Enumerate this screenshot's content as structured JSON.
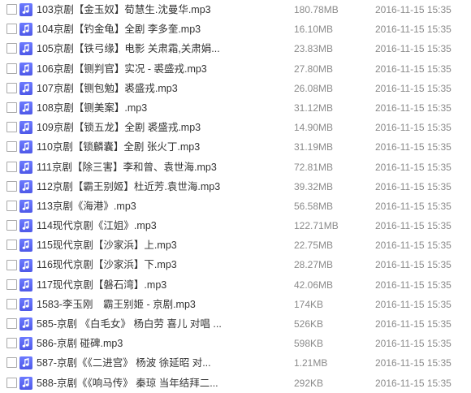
{
  "colors": {
    "icon_bg": "#5863f0",
    "text": "#333333",
    "meta_text": "#8a8a8a",
    "checkbox_border": "#a9a9a9"
  },
  "icons": {
    "file_type": "music-note-icon"
  },
  "files": [
    {
      "name": "103京剧【金玉奴】荀慧生.沈曼华.mp3",
      "size": "180.78MB",
      "date": "2016-11-15 15:35"
    },
    {
      "name": "104京剧【钓金龟】全剧 李多奎.mp3",
      "size": "16.10MB",
      "date": "2016-11-15 15:35"
    },
    {
      "name": "105京剧【铁弓缘】电影 关肃霜,关肃娟...",
      "size": "23.83MB",
      "date": "2016-11-15 15:35"
    },
    {
      "name": "106京剧【铡判官】实况 - 裘盛戎.mp3",
      "size": "27.80MB",
      "date": "2016-11-15 15:35"
    },
    {
      "name": "107京剧【铡包勉】裘盛戎.mp3",
      "size": "26.08MB",
      "date": "2016-11-15 15:35"
    },
    {
      "name": "108京剧【铡美案】.mp3",
      "size": "31.12MB",
      "date": "2016-11-15 15:35"
    },
    {
      "name": "109京剧【锁五龙】全剧 裘盛戎.mp3",
      "size": "14.90MB",
      "date": "2016-11-15 15:35"
    },
    {
      "name": "110京剧【锁麟囊】全剧 张火丁.mp3",
      "size": "31.19MB",
      "date": "2016-11-15 15:35"
    },
    {
      "name": "111京剧【除三害】李和曾、袁世海.mp3",
      "size": "72.81MB",
      "date": "2016-11-15 15:35"
    },
    {
      "name": "112京剧【霸王别姬】杜近芳.袁世海.mp3",
      "size": "39.32MB",
      "date": "2016-11-15 15:35"
    },
    {
      "name": "113京剧《海港》.mp3",
      "size": "56.58MB",
      "date": "2016-11-15 15:35"
    },
    {
      "name": "114现代京剧《江姐》.mp3",
      "size": "122.71MB",
      "date": "2016-11-15 15:35"
    },
    {
      "name": "115现代京剧【沙家浜】上.mp3",
      "size": "22.75MB",
      "date": "2016-11-15 15:35"
    },
    {
      "name": "116现代京剧【沙家浜】下.mp3",
      "size": "28.27MB",
      "date": "2016-11-15 15:35"
    },
    {
      "name": "117现代京剧【磐石湾】.mp3",
      "size": "42.06MB",
      "date": "2016-11-15 15:35"
    },
    {
      "name": "1583-李玉刚　霸王别姬 - 京剧.mp3",
      "size": "174KB",
      "date": "2016-11-15 15:35"
    },
    {
      "name": "585-京剧 《白毛女》 杨白劳 喜儿 对唱 ...",
      "size": "526KB",
      "date": "2016-11-15 15:35"
    },
    {
      "name": "586-京剧 碰碑.mp3",
      "size": "598KB",
      "date": "2016-11-15 15:35"
    },
    {
      "name": "587-京剧《《二进宫》 杨波 徐延昭 对...",
      "size": "1.21MB",
      "date": "2016-11-15 15:35"
    },
    {
      "name": "588-京剧《《响马传》 秦琼 当年结拜二...",
      "size": "292KB",
      "date": "2016-11-15 15:35"
    }
  ]
}
